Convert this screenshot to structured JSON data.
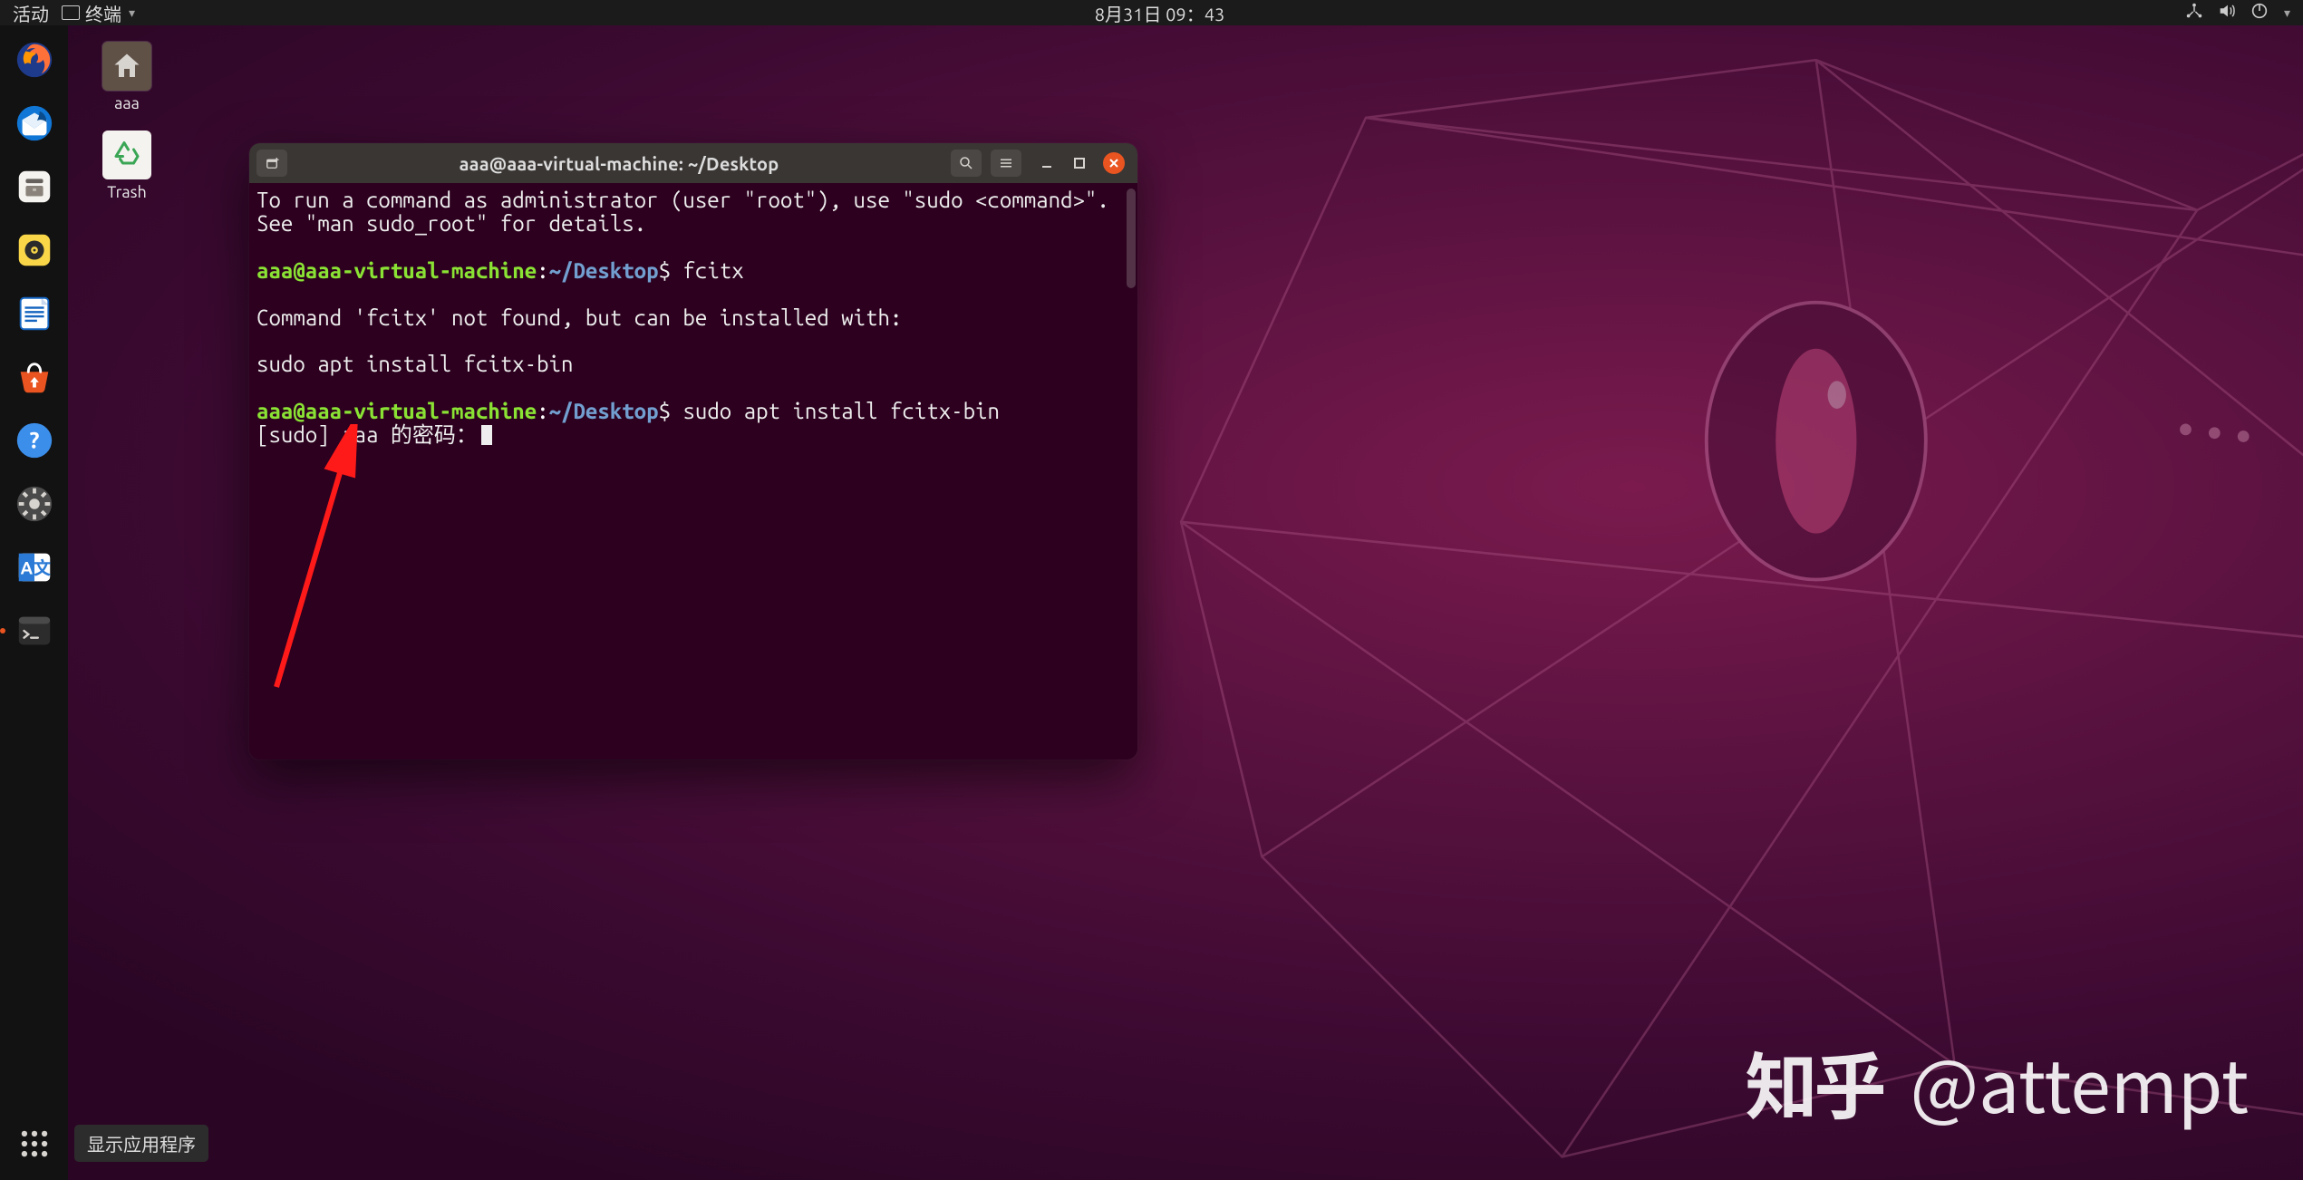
{
  "topbar": {
    "activities": "活动",
    "app_indicator": "终端",
    "datetime": "8月31日 09：43"
  },
  "dock": {
    "tooltip": "显示应用程序"
  },
  "desktop_icons": {
    "home": "aaa",
    "trash": "Trash"
  },
  "terminal": {
    "title": "aaa@aaa-virtual-machine: ~/Desktop",
    "prompt": {
      "user": "aaa",
      "host": "aaa-virtual-machine",
      "path": "~/Desktop"
    },
    "lines": {
      "msg1a": "To run a command as administrator (user \"root\"), use \"sudo <command>\".",
      "msg1b": "See \"man sudo_root\" for details.",
      "cmd1": "fcitx",
      "err1": "Command 'fcitx' not found, but can be installed with:",
      "suggest": "sudo apt install fcitx-bin",
      "cmd2": "sudo apt install fcitx-bin",
      "pw": "[sudo] aaa 的密码："
    }
  },
  "watermark": {
    "zhihu": "知乎",
    "handle": "@attempt"
  }
}
